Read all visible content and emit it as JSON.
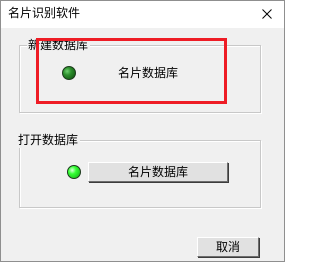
{
  "window": {
    "title": "名片识别软件"
  },
  "group_new": {
    "label": "新建数据库",
    "item_label": "名片数据库"
  },
  "group_open": {
    "label": "打开数据库",
    "button_label": "名片数据库"
  },
  "footer": {
    "cancel_label": "取消"
  },
  "colors": {
    "highlight": "#ee1c25",
    "led_dark": "#2c8f2c",
    "led_bright": "#33ff33"
  }
}
